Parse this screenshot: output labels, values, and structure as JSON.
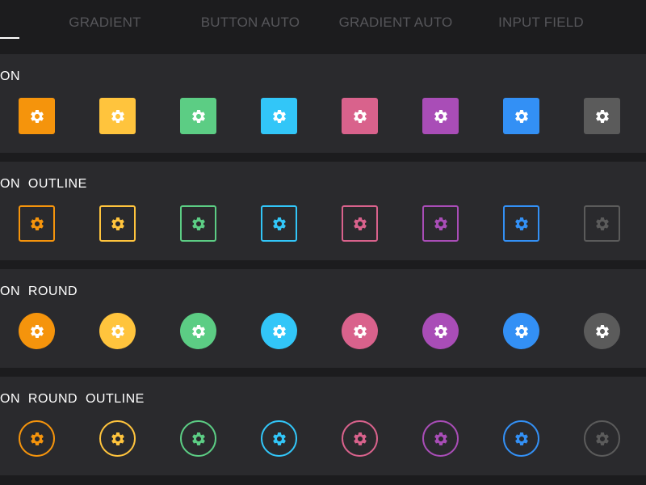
{
  "tabs": [
    {
      "label": ""
    },
    {
      "label": "GRADIENT"
    },
    {
      "label": "BUTTON AUTO"
    },
    {
      "label": "GRADIENT AUTO"
    },
    {
      "label": "INPUT FIELD"
    }
  ],
  "colors": {
    "background": "#1c1c1e",
    "section": "#2a2a2d",
    "tab_inactive": "#56565a",
    "orange": "#f5940c",
    "yellow": "#ffc43d",
    "green": "#5ccd84",
    "cyan": "#32c6f8",
    "pink": "#d9628c",
    "purple": "#a94db7",
    "blue": "#3390f5",
    "gray": "#5b5b5b"
  },
  "sections": [
    {
      "title": "ON",
      "style": "filled",
      "shape": "square"
    },
    {
      "title": "ON  OUTLINE",
      "style": "outline",
      "shape": "square"
    },
    {
      "title": "ON  ROUND",
      "style": "filled",
      "shape": "round"
    },
    {
      "title": "ON  ROUND  OUTLINE",
      "style": "outline",
      "shape": "round"
    }
  ],
  "buttons": [
    {
      "icon": "gear-icon",
      "color": "#f5940c"
    },
    {
      "icon": "gear-icon",
      "color": "#ffc43d"
    },
    {
      "icon": "gear-icon",
      "color": "#5ccd84"
    },
    {
      "icon": "gear-icon",
      "color": "#32c6f8"
    },
    {
      "icon": "gear-icon",
      "color": "#d9628c"
    },
    {
      "icon": "gear-icon",
      "color": "#a94db7"
    },
    {
      "icon": "gear-icon",
      "color": "#3390f5"
    },
    {
      "icon": "gear-icon",
      "color": "#5b5b5b"
    }
  ]
}
